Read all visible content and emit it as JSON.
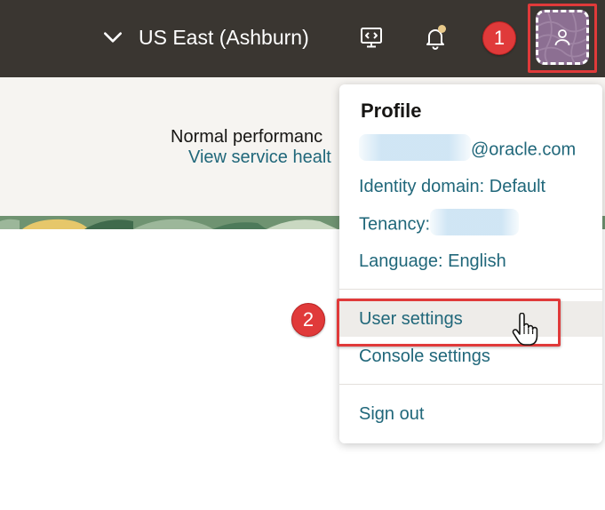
{
  "topbar": {
    "region_label": "US East (Ashburn)",
    "icons": [
      "chevron-down-icon",
      "developer-tools-icon",
      "notifications-bell-icon",
      "user-avatar-icon"
    ],
    "colors": {
      "background": "#3a3631",
      "notification_dot": "#e8c98a",
      "avatar": "#8c6f92"
    }
  },
  "status": {
    "title": "Normal performanc",
    "link": "View service healt"
  },
  "callouts": {
    "first": "1",
    "second": "2",
    "color": "#e03a3a"
  },
  "profile_menu": {
    "heading": "Profile",
    "email_suffix": "@oracle.com",
    "identity_domain": "Identity domain: Default",
    "tenancy_label": "Tenancy:",
    "language": "Language: English",
    "user_settings": "User settings",
    "console_settings": "Console settings",
    "sign_out": "Sign out",
    "link_color": "#20677a"
  }
}
